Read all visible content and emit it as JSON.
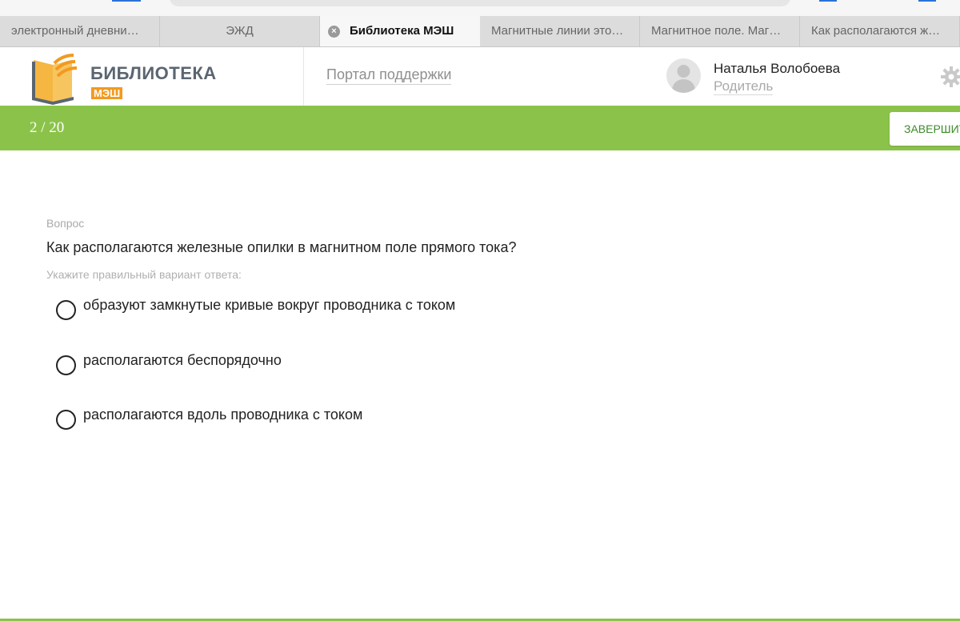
{
  "browser": {
    "tabs": [
      {
        "label": "электронный дневни…",
        "active": false
      },
      {
        "label": "ЭЖД",
        "active": false
      },
      {
        "label": "Библиотека МЭШ",
        "active": true
      },
      {
        "label": "Магнитные линии это…",
        "active": false
      },
      {
        "label": "Магнитное поле. Маг…",
        "active": false
      },
      {
        "label": "Как располагаются ж…",
        "active": false
      }
    ],
    "tab_close_glyph": "×"
  },
  "header": {
    "logo_title": "БИБЛИОТЕКА",
    "logo_sub": "МЭШ",
    "support_link": "Портал поддержки",
    "user_name": "Наталья Волобоева",
    "user_role": "Родитель"
  },
  "progress": {
    "count_label": "2 / 20",
    "current": 2,
    "total": 20,
    "finish_label": "ЗАВЕРШИТЬ"
  },
  "question": {
    "label": "Вопрос",
    "text": "Как располагаются железные опилки в магнитном поле прямого тока?",
    "hint": "Укажите правильный вариант ответа:",
    "options": [
      {
        "label": "образуют замкнутые кривые вокруг проводника с током",
        "selected": false
      },
      {
        "label": "располагаются беспорядочно",
        "selected": false
      },
      {
        "label": "располагаются вдоль проводника с током",
        "selected": false
      }
    ]
  },
  "icons": {
    "logo": "book-wifi-icon",
    "avatar": "user-silhouette-icon",
    "settings": "gear-icon",
    "tab_close": "close-circle-icon",
    "option_radio": "radio-unchecked-icon"
  },
  "colors": {
    "accent_green": "#8bc34a",
    "logo_orange": "#f29a1f",
    "logo_grey": "#5a6570",
    "finish_text": "#3d8a2a"
  }
}
